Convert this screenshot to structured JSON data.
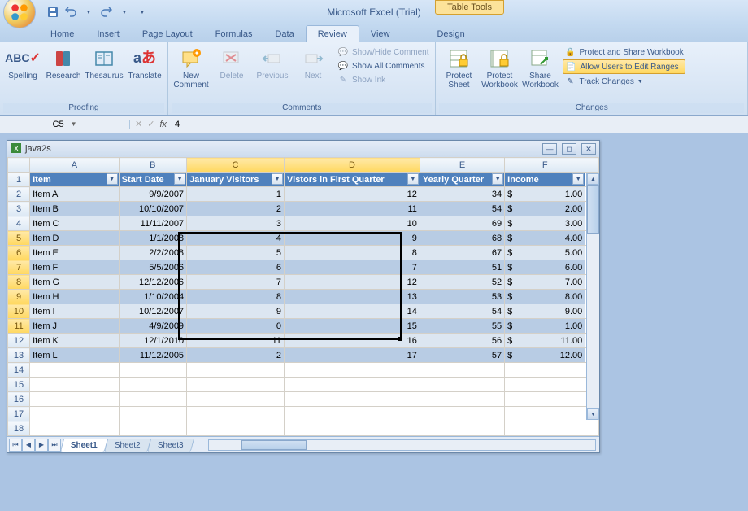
{
  "app_title": "Microsoft Excel (Trial)",
  "context_tab": "Table Tools",
  "tabs": [
    "Home",
    "Insert",
    "Page Layout",
    "Formulas",
    "Data",
    "Review",
    "View",
    "Design"
  ],
  "active_tab": "Review",
  "ribbon": {
    "proofing": {
      "label": "Proofing",
      "spelling": "Spelling",
      "research": "Research",
      "thesaurus": "Thesaurus",
      "translate": "Translate"
    },
    "comments": {
      "label": "Comments",
      "new_comment": "New Comment",
      "delete": "Delete",
      "previous": "Previous",
      "next": "Next",
      "show_hide": "Show/Hide Comment",
      "show_all": "Show All Comments",
      "show_ink": "Show Ink"
    },
    "changes": {
      "label": "Changes",
      "protect_sheet": "Protect Sheet",
      "protect_workbook": "Protect Workbook",
      "share_workbook": "Share Workbook",
      "protect_share": "Protect and Share Workbook",
      "allow_users": "Allow Users to Edit Ranges",
      "track_changes": "Track Changes"
    }
  },
  "name_box": "C5",
  "formula_value": "4",
  "workbook_title": "java2s",
  "columns": [
    "A",
    "B",
    "C",
    "D",
    "E",
    "F"
  ],
  "headers": {
    "item": "Item",
    "start_date": "Start Date",
    "jan_visitors": "January Visitors",
    "first_q": "Vistors in First Quarter",
    "yearly_q": "Yearly Quarter",
    "income": "Income"
  },
  "rows": [
    {
      "n": 2,
      "item": "Item A",
      "date": "9/9/2007",
      "jan": "1",
      "fq": "12",
      "yq": "34",
      "inc": "1.00"
    },
    {
      "n": 3,
      "item": "Item B",
      "date": "10/10/2007",
      "jan": "2",
      "fq": "11",
      "yq": "54",
      "inc": "2.00"
    },
    {
      "n": 4,
      "item": "Item C",
      "date": "11/11/2007",
      "jan": "3",
      "fq": "10",
      "yq": "69",
      "inc": "3.00"
    },
    {
      "n": 5,
      "item": "Item D",
      "date": "1/1/2008",
      "jan": "4",
      "fq": "9",
      "yq": "68",
      "inc": "4.00"
    },
    {
      "n": 6,
      "item": "Item E",
      "date": "2/2/2008",
      "jan": "5",
      "fq": "8",
      "yq": "67",
      "inc": "5.00"
    },
    {
      "n": 7,
      "item": "Item F",
      "date": "5/5/2006",
      "jan": "6",
      "fq": "7",
      "yq": "51",
      "inc": "6.00"
    },
    {
      "n": 8,
      "item": "Item G",
      "date": "12/12/2006",
      "jan": "7",
      "fq": "12",
      "yq": "52",
      "inc": "7.00"
    },
    {
      "n": 9,
      "item": "Item H",
      "date": "1/10/2004",
      "jan": "8",
      "fq": "13",
      "yq": "53",
      "inc": "8.00"
    },
    {
      "n": 10,
      "item": "Item I",
      "date": "10/12/2007",
      "jan": "9",
      "fq": "14",
      "yq": "54",
      "inc": "9.00"
    },
    {
      "n": 11,
      "item": "Item J",
      "date": "4/9/2009",
      "jan": "0",
      "fq": "15",
      "yq": "55",
      "inc": "1.00"
    },
    {
      "n": 12,
      "item": "Item K",
      "date": "12/1/2010",
      "jan": "11",
      "fq": "16",
      "yq": "56",
      "inc": "11.00"
    },
    {
      "n": 13,
      "item": "Item L",
      "date": "11/12/2005",
      "jan": "2",
      "fq": "17",
      "yq": "57",
      "inc": "12.00"
    }
  ],
  "empty_rows": [
    14,
    15,
    16,
    17,
    18
  ],
  "sheets": [
    "Sheet1",
    "Sheet2",
    "Sheet3"
  ],
  "active_sheet": "Sheet1",
  "currency": "$",
  "selected_rows": [
    5,
    6,
    7,
    8,
    9,
    10,
    11
  ],
  "selected_cols": [
    "C",
    "D"
  ]
}
